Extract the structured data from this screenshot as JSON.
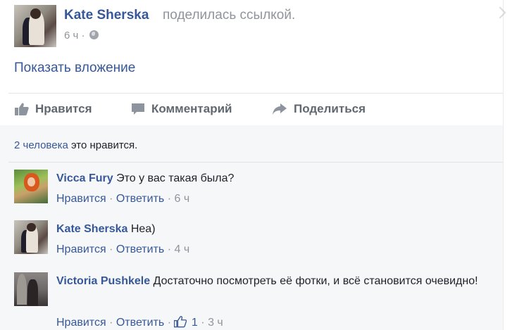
{
  "post": {
    "author": "Kate Sherska",
    "action": "поделилась ссылкой.",
    "time": "6 ч",
    "attachment_link": "Показать вложение"
  },
  "actions": {
    "like": "Нравится",
    "comment": "Комментарий",
    "share": "Поделиться"
  },
  "likes_summary": {
    "count_link": "2 человека",
    "rest": " это нравится."
  },
  "comments": [
    {
      "author": "Vicca Fury",
      "text": "Это у вас такая была?",
      "like": "Нравится",
      "reply": "Ответить",
      "time": "6 ч"
    },
    {
      "author": "Kate Sherska",
      "text": "Неа)",
      "like": "Нравится",
      "reply": "Ответить",
      "time": "4 ч"
    },
    {
      "author": "Victoria Pushkele",
      "text": "Достаточно посмотреть её фотки, и всё становится очевидно!",
      "like": "Нравится",
      "reply": "Ответить",
      "likes": "1",
      "time": "3 ч"
    }
  ],
  "colors": {
    "link": "#365899",
    "muted": "#90949c",
    "comments_bg": "#f6f7f9"
  }
}
